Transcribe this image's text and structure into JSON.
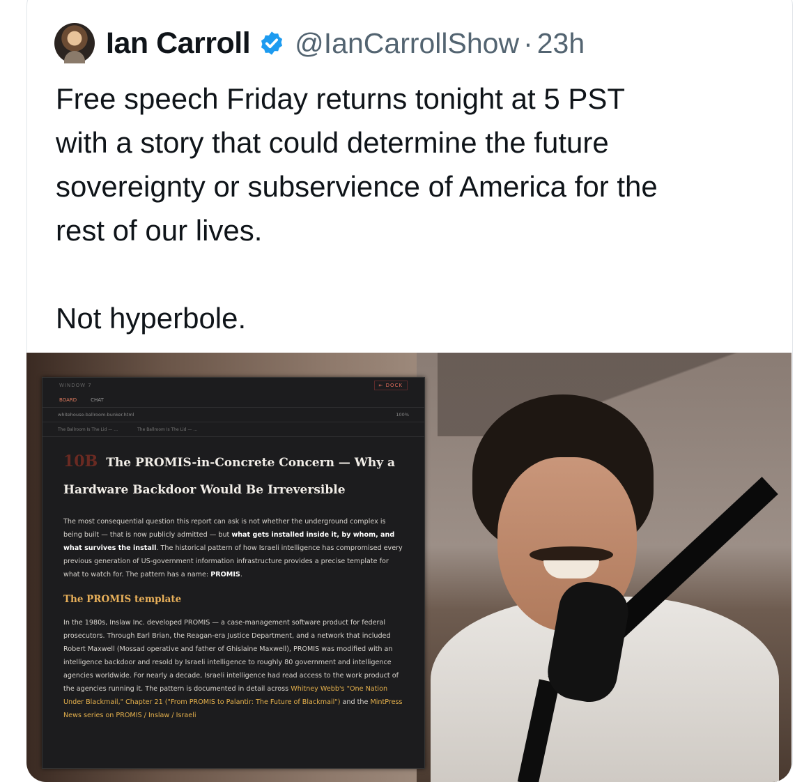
{
  "tweet": {
    "author_name": "Ian Carroll",
    "handle": "@IanCarrollShow",
    "separator": "·",
    "time": "23h",
    "text": "Free speech Friday returns tonight at 5 PST\nwith a story that could determine the future\nsovereignty or subservience of America for the\nrest of our lives.\n\nNot hyperbole."
  },
  "icons": {
    "avatar": "avatar-photo",
    "verified": "verified-badge-icon"
  },
  "colors": {
    "verified": "#1d9bf0",
    "handle": "#536471",
    "text": "#0f1419"
  },
  "screen": {
    "window_label": "WINDOW 7",
    "dock_label": "⇤ DOCK",
    "tab_board": "BOARD",
    "tab_chat": "CHAT",
    "file_path": "whitehouse-ballroom-bunker.html",
    "zoom": "100%",
    "doc_tab_1": "The Ballroom Is The Lid — …",
    "doc_tab_2": "The Ballroom Is The Lid — …",
    "section_number": "10B",
    "section_title": "The PROMIS-in-Concrete Concern — Why a Hardware Backdoor Would Be Irreversible",
    "p1_a": "The most consequential question this report can ask is not whether the underground complex is being built — that is now publicly admitted — but ",
    "p1_bold": "what gets installed inside it, by whom, and what survives the install",
    "p1_b": ". The historical pattern of how Israeli intelligence has compromised every previous generation of US-government information infrastructure provides a precise template for what to watch for. The pattern has a name: ",
    "p1_name": "PROMIS",
    "p1_end": ".",
    "subheading": "The PROMIS template",
    "p2_a": "In the 1980s, Inslaw Inc. developed PROMIS — a case-management software product for federal prosecutors. Through Earl Brian, the Reagan-era Justice Department, and a network that included Robert Maxwell (Mossad operative and father of Ghislaine Maxwell), PROMIS was modified with an intelligence backdoor and resold by Israeli intelligence to roughly 80 government and intelligence agencies worldwide. For nearly a decade, Israeli intelligence had read access to the work product of the agencies running it. The pattern is documented in detail across ",
    "p2_link1": "Whitney Webb's \"One Nation Under Blackmail,\" Chapter 21 (\"From PROMIS to Palantir: The Future of Blackmail\")",
    "p2_b": " and the ",
    "p2_link2": "MintPress News series on PROMIS / Inslaw / Israeli"
  }
}
